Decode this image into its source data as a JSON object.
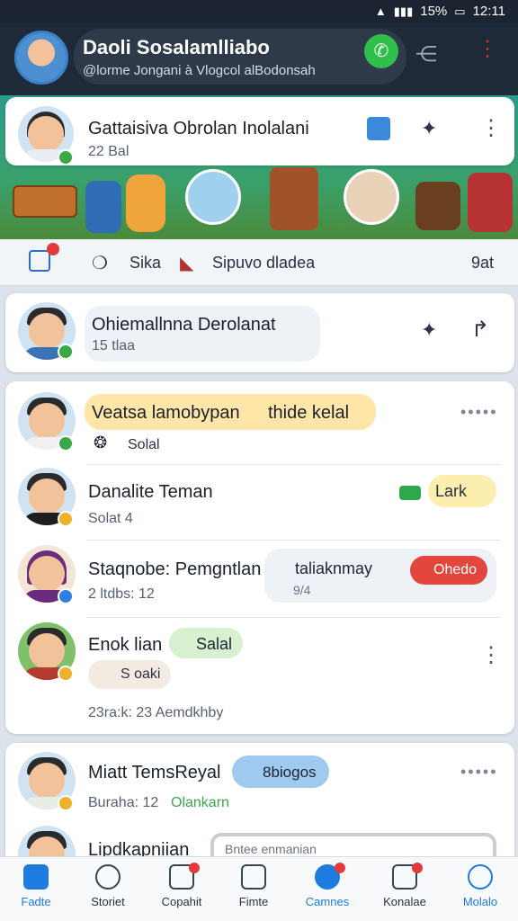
{
  "status_bar": {
    "battery": "15%",
    "time": "12:11"
  },
  "header": {
    "title": "Daoli Sosalamlliabo",
    "subtitle": "@lorme Jongani à Vlogcol alBodonsah"
  },
  "pinned_chat": {
    "name": "Gattaisiva Obrolan Inolalani",
    "meta": "22 Bal"
  },
  "tabs": [
    {
      "label": "Sika"
    },
    {
      "label": "Sipuvo dladea"
    },
    {
      "label": "9at"
    }
  ],
  "chat_solo": {
    "name": "Ohiemallnna Derolanat",
    "meta": "15 tlaa"
  },
  "chats": [
    {
      "name": "Veatsa lamobypan",
      "tag": "thide kelal",
      "meta": "Solal"
    },
    {
      "name": "Danalite Teman",
      "meta": "Solat 4",
      "tag": "Lark"
    },
    {
      "name": "Staqnobe: Pemgntlan",
      "meta": "2 ltdbs: 12",
      "bubble": "taliaknmay",
      "bubble_sub": "9/4",
      "button": "Ohedo"
    },
    {
      "name": "Enok lian",
      "tag": "Salal",
      "chip": "S oaki",
      "meta": "23ra:k: 23  Aemdkhby"
    }
  ],
  "chat_more": [
    {
      "name": "Miatt TemsReyal",
      "tag": "8biogos",
      "meta": "Buraha: 12",
      "meta2": "Olankarn"
    },
    {
      "name": "Lipdkapniian",
      "input_placeholder": "Bntee enmanian"
    }
  ],
  "bottom_nav": [
    {
      "label": "Fadte"
    },
    {
      "label": "Storiet"
    },
    {
      "label": "Copahit"
    },
    {
      "label": "Fimte"
    },
    {
      "label": "Camnes"
    },
    {
      "label": "Konalae"
    },
    {
      "label": "Molalo"
    }
  ]
}
